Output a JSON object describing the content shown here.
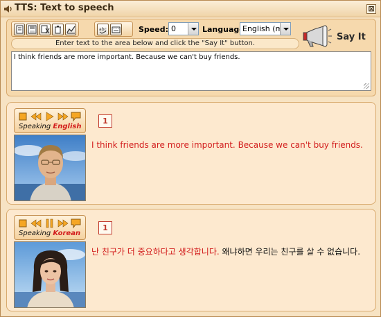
{
  "window": {
    "title": "TTS: Text to speech",
    "close_glyph": "⊠"
  },
  "toolbar": {
    "speed_label": "Speed:",
    "speed_value": "0",
    "language_label": "Language:",
    "language_value": "English (ma",
    "say_it_label": "Say It",
    "icons": [
      "new-doc-icon",
      "save-icon",
      "cut-icon",
      "delete-icon",
      "chart-icon",
      "spellcheck-icon",
      "keyboard-icon"
    ]
  },
  "hint": "Enter text to the area below and click the \"Say It\" button.",
  "input": {
    "value": "I think friends are more important. Because we can't buy friends."
  },
  "panels": [
    {
      "caption_prefix": "Speaking ",
      "language": "English",
      "number": "1",
      "text_spoken": "I think friends are more important. Because we can't buy friends.",
      "text_rest": ""
    },
    {
      "caption_prefix": "Speaking ",
      "language": "Korean",
      "number": "1",
      "text_spoken": "난 친구가 더 중요하다고 생각합니다.",
      "text_rest": " 왜냐하면 우리는 친구를 살 수 없습니다."
    }
  ],
  "colors": {
    "accent_red": "#d21c1c",
    "panel_bg": "#fde9cf",
    "window_bg": "#f7e3c3"
  }
}
